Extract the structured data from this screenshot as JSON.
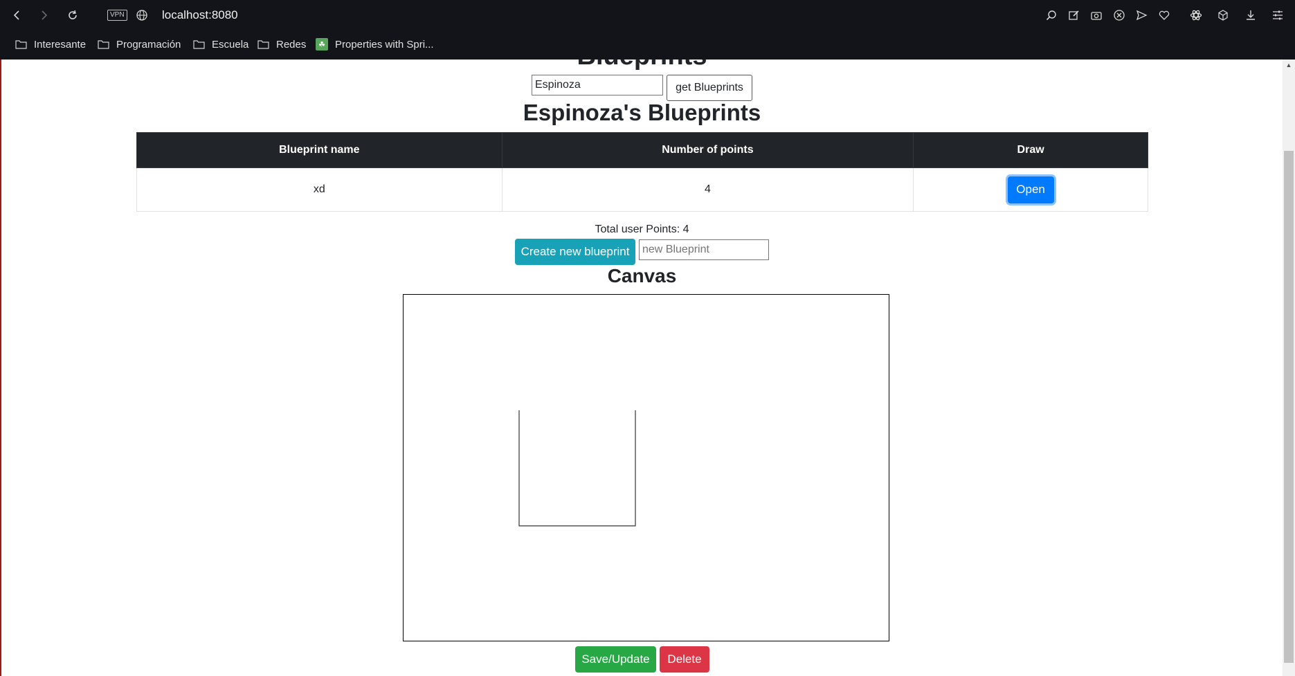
{
  "browser": {
    "url": "localhost:8080",
    "vpn_label": "VPN",
    "bookmarks": [
      {
        "label": "Interesante",
        "icon": "folder-icon"
      },
      {
        "label": "Programación",
        "icon": "folder-icon"
      },
      {
        "label": "Escuela",
        "icon": "folder-icon"
      },
      {
        "label": "Redes",
        "icon": "folder-icon"
      },
      {
        "label": "Properties with Spri...",
        "icon": "spring-leaf-icon"
      }
    ],
    "toolbar_icons": [
      "back-icon",
      "forward-icon",
      "reload-icon",
      "globe-icon",
      "search-page-icon",
      "edit-icon",
      "camera-icon",
      "close-circle-icon",
      "send-icon",
      "heart-icon",
      "atom-icon",
      "cube-icon",
      "download-icon",
      "settings-sliders-icon"
    ]
  },
  "page": {
    "heading": "Blueprints",
    "author_input_value": "Espinoza",
    "get_button": "get Blueprints",
    "user_title": "Espinoza's Blueprints",
    "table": {
      "headers": [
        "Blueprint name",
        "Number of points",
        "Draw"
      ],
      "rows": [
        {
          "name": "xd",
          "points": "4",
          "action": "Open"
        }
      ]
    },
    "total_points": "Total user Points: 4",
    "create_button": "Create new blueprint",
    "new_input_placeholder": "new Blueprint",
    "canvas_title": "Canvas",
    "save_button": "Save/Update",
    "delete_button": "Delete"
  },
  "colors": {
    "chrome_bg": "#12141a",
    "table_header_bg": "#212529",
    "primary": "#007bff",
    "info": "#17a2b8",
    "success": "#28a745",
    "danger": "#dc3545"
  }
}
